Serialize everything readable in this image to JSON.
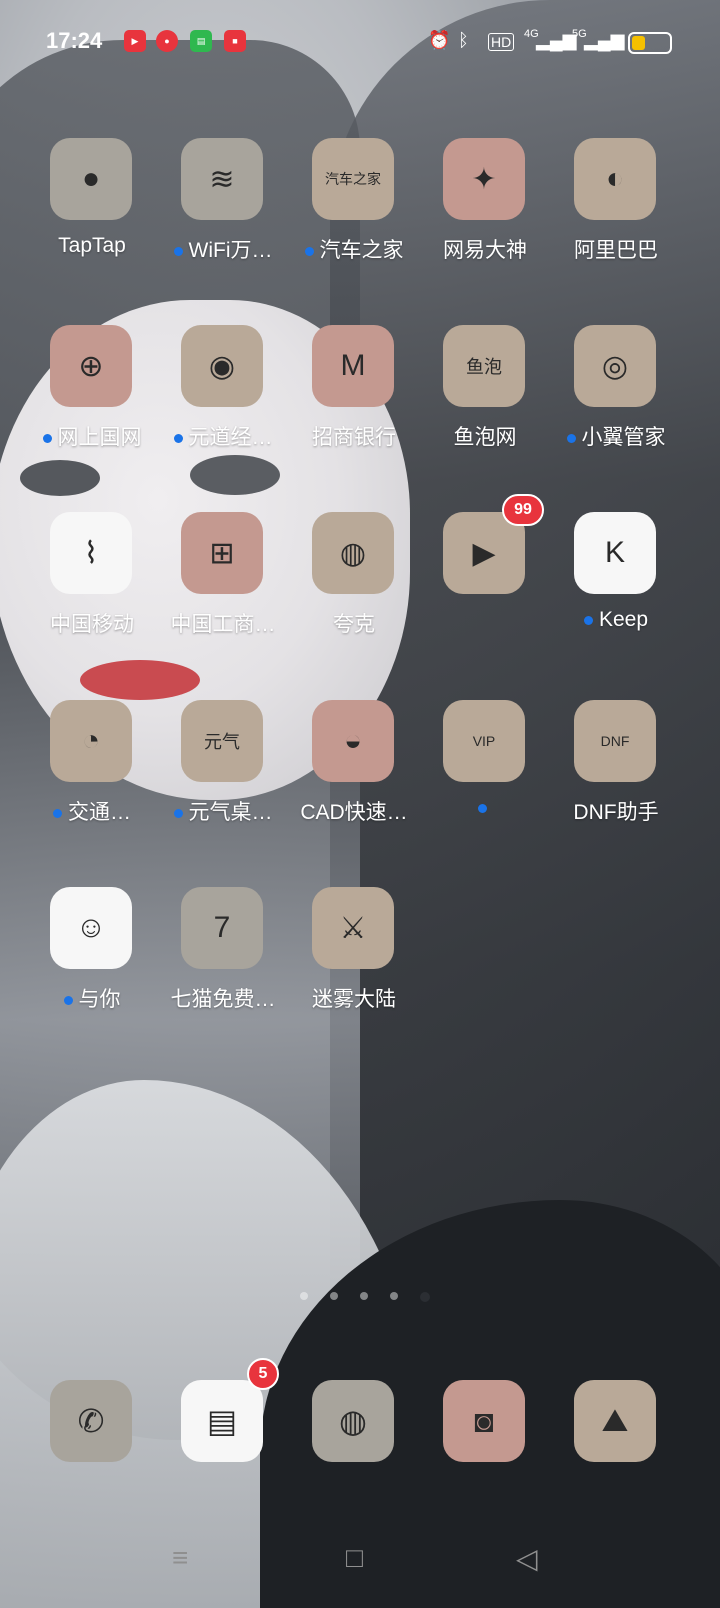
{
  "status_bar": {
    "time": "17:24",
    "notification_icons": [
      "video-app-icon",
      "red-mascot-icon",
      "wechat-style-icon",
      "red-app-icon"
    ],
    "right_icons": [
      "alarm-icon",
      "bluetooth-icon",
      "hd-icon",
      "4g-signal-icon",
      "5g-signal-icon"
    ],
    "hd_label": "HD",
    "net1": "4G",
    "net2": "5G",
    "battery_level": 0.35
  },
  "apps": [
    {
      "label": "TapTap",
      "new": false,
      "icon": "taptap-icon",
      "glyph": "●",
      "tile": "grey"
    },
    {
      "label": "WiFi万…",
      "new": true,
      "icon": "wifi-icon",
      "glyph": "≋",
      "tile": "grey"
    },
    {
      "label": "汽车之家",
      "new": true,
      "icon": "autohome-icon",
      "glyph": "汽车之家",
      "tile": "beige"
    },
    {
      "label": "网易大神",
      "new": false,
      "icon": "netease-dashen-icon",
      "glyph": "✦",
      "tile": "rose"
    },
    {
      "label": "阿里巴巴",
      "new": false,
      "icon": "alibaba-icon",
      "glyph": "◐",
      "tile": "beige"
    },
    {
      "label": "网上国网",
      "new": true,
      "icon": "state-grid-icon",
      "glyph": "⊕",
      "tile": "rose"
    },
    {
      "label": "元道经…",
      "new": true,
      "icon": "camera-lens-icon",
      "glyph": "◉",
      "tile": "beige"
    },
    {
      "label": "招商银行",
      "new": false,
      "icon": "cmb-bank-icon",
      "glyph": "M",
      "tile": "rose"
    },
    {
      "label": "鱼泡网",
      "new": false,
      "icon": "yupao-icon",
      "glyph": "鱼泡",
      "tile": "beige"
    },
    {
      "label": "小翼管家",
      "new": true,
      "icon": "xiaoyi-icon",
      "glyph": "◎",
      "tile": "beige"
    },
    {
      "label": "中国移动",
      "new": false,
      "icon": "china-mobile-icon",
      "glyph": "⌇",
      "tile": "white"
    },
    {
      "label": "中国工商…",
      "new": false,
      "icon": "icbc-icon",
      "glyph": "⊞",
      "tile": "rose"
    },
    {
      "label": "夸克",
      "new": false,
      "icon": "quark-icon",
      "glyph": "◍",
      "tile": "beige"
    },
    {
      "label": "",
      "new": false,
      "icon": "kuaishou-icon",
      "glyph": "▶",
      "tile": "beige",
      "badge": "99"
    },
    {
      "label": "Keep",
      "new": true,
      "icon": "keep-icon",
      "glyph": "K",
      "tile": "white"
    },
    {
      "label": "交通…",
      "new": true,
      "icon": "traffic-app-icon",
      "glyph": "◔",
      "tile": "beige"
    },
    {
      "label": "元气桌…",
      "new": true,
      "icon": "yuanqi-desktop-icon",
      "glyph": "元气",
      "tile": "beige"
    },
    {
      "label": "CAD快速…",
      "new": false,
      "icon": "cad-icon",
      "glyph": "◒",
      "tile": "rose"
    },
    {
      "label": "",
      "new": true,
      "icon": "vip-video-icon",
      "glyph": "VIP",
      "tile": "beige"
    },
    {
      "label": "DNF助手",
      "new": false,
      "icon": "dnf-helper-icon",
      "glyph": "DNF",
      "tile": "beige"
    },
    {
      "label": "与你",
      "new": true,
      "icon": "yuni-chat-icon",
      "glyph": "☺",
      "tile": "white"
    },
    {
      "label": "七猫免费…",
      "new": false,
      "icon": "qimao-icon",
      "glyph": "7",
      "tile": "grey"
    },
    {
      "label": "迷雾大陆",
      "new": false,
      "icon": "mist-continent-icon",
      "glyph": "⚔",
      "tile": "beige"
    }
  ],
  "pager": {
    "count": 5,
    "active_index": 4
  },
  "dock": [
    {
      "icon": "phone-icon",
      "glyph": "✆",
      "tile": "grey"
    },
    {
      "icon": "messages-icon",
      "glyph": "▤",
      "tile": "white",
      "badge": "5"
    },
    {
      "icon": "browser-icon",
      "glyph": "◍",
      "tile": "grey"
    },
    {
      "icon": "camera-icon",
      "glyph": "◙",
      "tile": "rose"
    },
    {
      "icon": "gallery-icon",
      "glyph": "⛰",
      "tile": "beige"
    }
  ],
  "nav": {
    "menu": "≡",
    "home": "□",
    "back": "◁"
  }
}
